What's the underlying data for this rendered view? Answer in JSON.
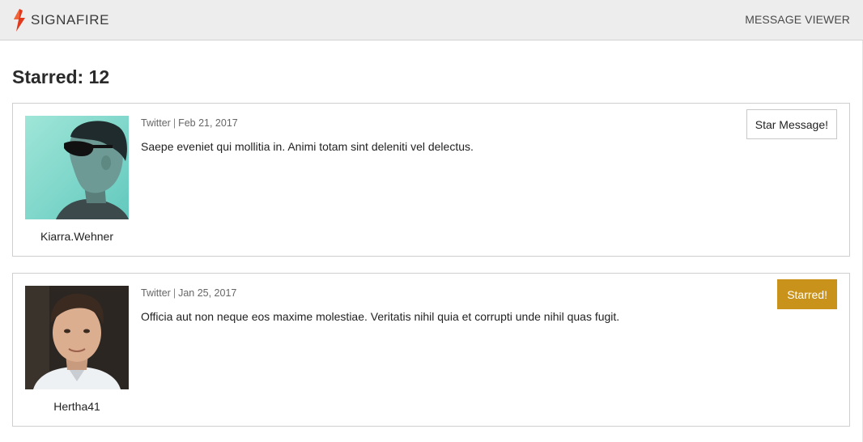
{
  "header": {
    "brand": "SIGNAFIRE",
    "nav_title": "MESSAGE VIEWER"
  },
  "page": {
    "title": "Starred: 12"
  },
  "messages": [
    {
      "username": "Kiarra.Wehner",
      "source": "Twitter",
      "date": "Feb 21, 2017",
      "text": "Saepe eveniet qui mollitia in. Animi totam sint deleniti vel delectus.",
      "button_label": "Star Message!",
      "starred": false
    },
    {
      "username": "Hertha41",
      "source": "Twitter",
      "date": "Jan 25, 2017",
      "text": "Officia aut non neque eos maxime molestiae. Veritatis nihil quia et corrupti unde nihil quas fugit.",
      "button_label": "Starred!",
      "starred": true
    }
  ],
  "colors": {
    "brand_flame": "#e0391b",
    "starred_button": "#c8921b",
    "header_bg": "#ededed"
  },
  "icons": {
    "logo": "flame-logo-icon"
  }
}
